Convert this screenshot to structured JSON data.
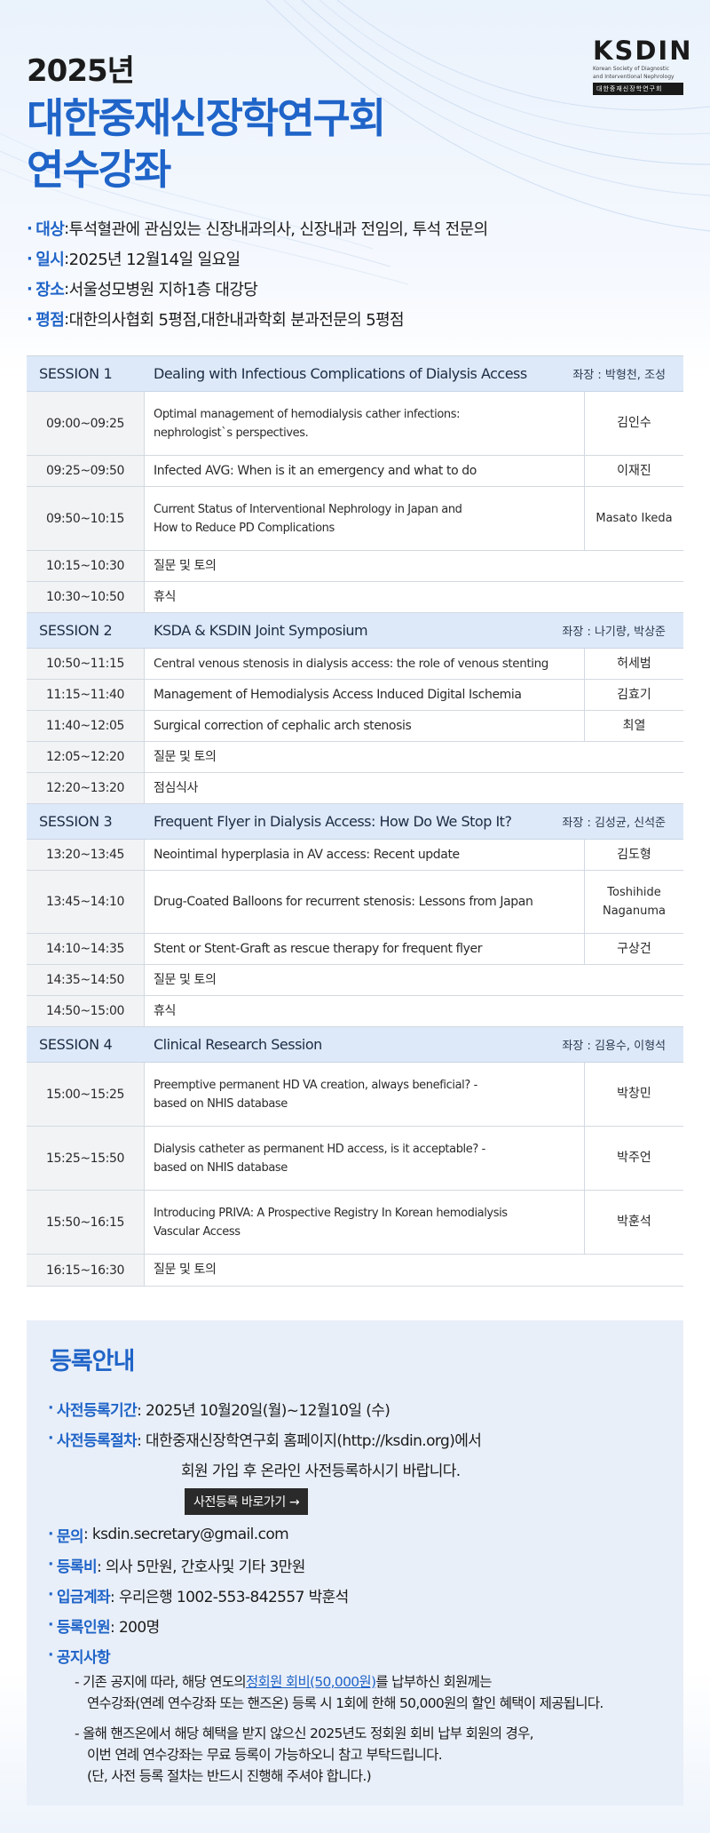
{
  "header": {
    "year": "2025년",
    "title_line1": "대한중재신장학연구회",
    "title_line2": "연수강좌",
    "logo_mark": "KSDIN",
    "logo_sub1": "Korean Society of Diagnostic",
    "logo_sub2": "and Interventional Nephrology",
    "logo_bar": "대한중재신장학연구회"
  },
  "info": [
    {
      "label": "대상",
      "sep": " : ",
      "value": "투석혈관에 관심있는 신장내과의사, 신장내과 전임의, 투석 전문의"
    },
    {
      "label": "일시",
      "sep": " : ",
      "value": "2025년 12월14일 일요일"
    },
    {
      "label": "장소",
      "sep": " : ",
      "value": "서울성모병원 지하1층 대강당"
    },
    {
      "label": "평점",
      "sep": " : ",
      "value": "대한의사협회 5평점,대한내과학회 분과전문의 5평점"
    }
  ],
  "schedule": {
    "session1": {
      "id": "SESSION 1",
      "title": "Dealing with Infectious Complications of Dialysis Access",
      "chair": "좌장 : 박형천, 조성",
      "rows": [
        {
          "time": "09:00~09:25",
          "topic1": "Optimal management of hemodialysis cather infections:",
          "topic2": "nephrologist`s perspectives.",
          "speaker": "김인수"
        },
        {
          "time": "09:25~09:50",
          "topic1": "Infected AVG: When is it an emergency and what to do",
          "speaker": "이재진"
        },
        {
          "time": "09:50~10:15",
          "topic1": "Current Status of Interventional Nephrology in Japan and",
          "topic2": "How to Reduce PD Complications",
          "speaker": "Masato Ikeda"
        },
        {
          "time": "10:15~10:30",
          "topic1": "질문 및 토의"
        },
        {
          "time": "10:30~10:50",
          "topic1": "휴식"
        }
      ]
    },
    "session2": {
      "id": "SESSION 2",
      "title": "KSDA & KSDIN Joint Symposium",
      "chair": "좌장 : 나기량, 박상준",
      "rows": [
        {
          "time": "10:50~11:15",
          "topic1": "Central venous stenosis in dialysis access: the role of venous stenting",
          "speaker": "허세범"
        },
        {
          "time": "11:15~11:40",
          "topic1": "Management of Hemodialysis Access Induced Digital Ischemia",
          "speaker": "김효기"
        },
        {
          "time": "11:40~12:05",
          "topic1": "Surgical correction of cephalic arch stenosis",
          "speaker": "최열"
        },
        {
          "time": "12:05~12:20",
          "topic1": "질문 및 토의"
        },
        {
          "time": "12:20~13:20",
          "topic1": "점심식사"
        }
      ]
    },
    "session3": {
      "id": "SESSION 3",
      "title": "Frequent Flyer in Dialysis Access: How Do We Stop It?",
      "chair": "좌장 : 김성균, 신석준",
      "rows": [
        {
          "time": "13:20~13:45",
          "topic1": "Neointimal hyperplasia in AV access: Recent update",
          "speaker": "김도형"
        },
        {
          "time": "13:45~14:10",
          "topic1": "Drug-Coated Balloons for recurrent stenosis: Lessons from Japan",
          "speaker1": "Toshihide",
          "speaker2": "Naganuma"
        },
        {
          "time": "14:10~14:35",
          "topic1": "Stent or Stent-Graft as rescue therapy for frequent flyer",
          "speaker": "구상건"
        },
        {
          "time": "14:35~14:50",
          "topic1": "질문 및 토의"
        },
        {
          "time": "14:50~15:00",
          "topic1": "휴식"
        }
      ]
    },
    "session4": {
      "id": "SESSION 4",
      "title": "Clinical Research Session",
      "chair": "좌장 : 김용수, 이형석",
      "rows": [
        {
          "time": "15:00~15:25",
          "topic1": "Preemptive permanent HD VA creation, always beneficial? -",
          "topic2": "based on NHIS database",
          "speaker": "박창민"
        },
        {
          "time": "15:25~15:50",
          "topic1": "Dialysis catheter as permanent HD access, is it acceptable? -",
          "topic2": "based on NHIS database",
          "speaker": "박주언"
        },
        {
          "time": "15:50~16:15",
          "topic1": "Introducing PRIVA: A Prospective Registry In Korean hemodialysis",
          "topic2": "Vascular Access",
          "speaker": "박훈석"
        },
        {
          "time": "16:15~16:30",
          "topic1": "질문 및 토의"
        }
      ]
    }
  },
  "registration": {
    "title": "등록안내",
    "period_label": "사전등록기간",
    "period_value": " : 2025년 10월20일(월)~12월10일 (수)",
    "procedure_label": "사전등록절차",
    "procedure_value1": " : 대한중재신장학연구회 홈페이지(http://ksdin.org)에서",
    "procedure_value2": "회원 가입 후 온라인 사전등록하시기 바랍니다.",
    "button_label": "사전등록 바로가기 →",
    "contact_label": "문의",
    "contact_value": " : ksdin.secretary@gmail.com",
    "fee_label": "등록비",
    "fee_value": " : 의사 5만원, 간호사및 기타 3만원",
    "account_label": "입금계좌",
    "account_value": " : 우리은행 1002-553-842557 박훈석",
    "capacity_label": "등록인원",
    "capacity_value": " : 200명",
    "notice_label": "공지사항",
    "notice1_a": "- 기존 공지에 따라, 해당 연도의 ",
    "notice1_hl": "정회원 회비(50,000원)",
    "notice1_b": "를 납부하신 회원께는",
    "notice1_line2": "연수강좌(연례 연수강좌 또는 핸즈온) 등록 시 1회에 한해 50,000원의 할인 혜택이 제공됩니다.",
    "notice2_line1": "- 올해 핸즈온에서 해당 혜택을 받지 않으신 2025년도 정회원 회비 납부 회원의 경우,",
    "notice2_line2": "이번 연례 연수강좌는 무료 등록이 가능하오니 참고 부탁드립니다.",
    "notice2_line3": "(단, 사전 등록 절차는 반드시 진행해 주셔야 합니다.)"
  },
  "colors": {
    "accent": "#1f64c8",
    "session_bg": "#dde9f8",
    "time_bg": "#f2f3f5",
    "reg_bg": "#e9eff8"
  }
}
